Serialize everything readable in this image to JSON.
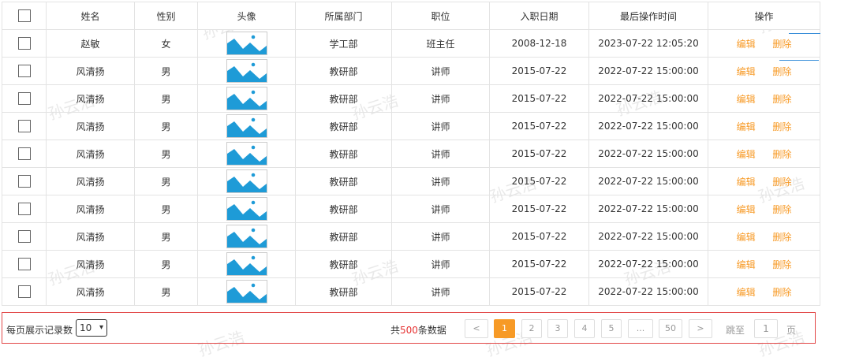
{
  "watermark": "孙云浩",
  "table": {
    "headers": [
      "姓名",
      "性别",
      "头像",
      "所属部门",
      "职位",
      "入职日期",
      "最后操作时间",
      "操作"
    ],
    "rows": [
      {
        "name": "赵敏",
        "gender": "女",
        "dept": "学工部",
        "position": "班主任",
        "hire_date": "2008-12-18",
        "last_op": "2023-07-22 12:05:20"
      },
      {
        "name": "风清扬",
        "gender": "男",
        "dept": "教研部",
        "position": "讲师",
        "hire_date": "2015-07-22",
        "last_op": "2022-07-22 15:00:00"
      },
      {
        "name": "风清扬",
        "gender": "男",
        "dept": "教研部",
        "position": "讲师",
        "hire_date": "2015-07-22",
        "last_op": "2022-07-22 15:00:00"
      },
      {
        "name": "风清扬",
        "gender": "男",
        "dept": "教研部",
        "position": "讲师",
        "hire_date": "2015-07-22",
        "last_op": "2022-07-22 15:00:00"
      },
      {
        "name": "风清扬",
        "gender": "男",
        "dept": "教研部",
        "position": "讲师",
        "hire_date": "2015-07-22",
        "last_op": "2022-07-22 15:00:00"
      },
      {
        "name": "风清扬",
        "gender": "男",
        "dept": "教研部",
        "position": "讲师",
        "hire_date": "2015-07-22",
        "last_op": "2022-07-22 15:00:00"
      },
      {
        "name": "风清扬",
        "gender": "男",
        "dept": "教研部",
        "position": "讲师",
        "hire_date": "2015-07-22",
        "last_op": "2022-07-22 15:00:00"
      },
      {
        "name": "风清扬",
        "gender": "男",
        "dept": "教研部",
        "position": "讲师",
        "hire_date": "2015-07-22",
        "last_op": "2022-07-22 15:00:00"
      },
      {
        "name": "风清扬",
        "gender": "男",
        "dept": "教研部",
        "position": "讲师",
        "hire_date": "2015-07-22",
        "last_op": "2022-07-22 15:00:00"
      },
      {
        "name": "风清扬",
        "gender": "男",
        "dept": "教研部",
        "position": "讲师",
        "hire_date": "2015-07-22",
        "last_op": "2022-07-22 15:00:00"
      }
    ],
    "edit_label": "编辑",
    "delete_label": "删除",
    "avatar_icon": "image-placeholder-icon",
    "checkbox_icon": "checkbox-icon"
  },
  "footer": {
    "per_page_label": "每页展示记录数",
    "per_page_value": "10",
    "total_prefix": "共",
    "total_count": "500",
    "total_suffix": "条数据",
    "pages": [
      "<",
      "1",
      "2",
      "3",
      "4",
      "5",
      "...",
      "50",
      ">"
    ],
    "active_page": "1",
    "jump_label": "跳至",
    "jump_value": "1",
    "jump_suffix": "页"
  },
  "colors": {
    "accent": "#f79a26",
    "count": "#e63232",
    "frame": "#e24848",
    "avatar_fill": "#1e9bd7",
    "deco_line": "#3a8fd9"
  }
}
